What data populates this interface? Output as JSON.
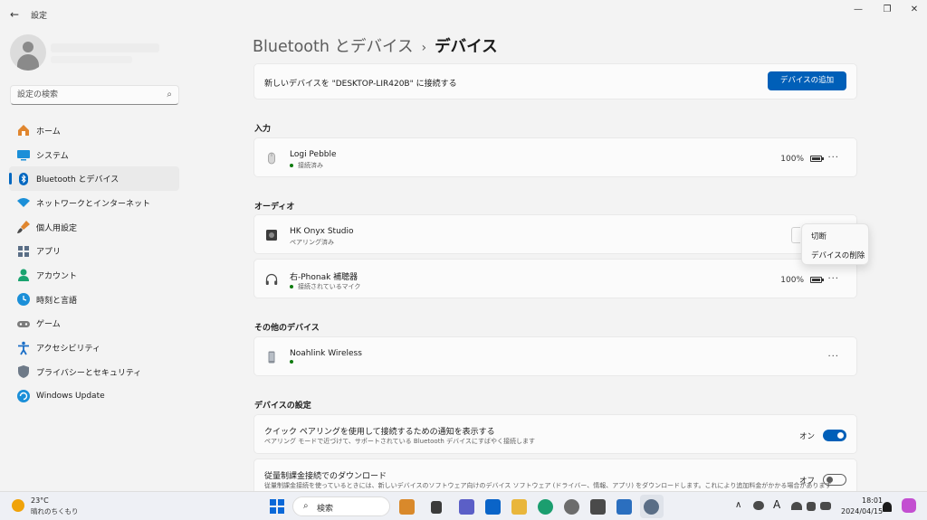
{
  "window": {
    "title": "設定",
    "back_icon": "←",
    "minimize_icon": "—",
    "maximize_icon": "❐",
    "close_icon": "✕"
  },
  "sidebar": {
    "search_placeholder": "設定の検索",
    "search_icon": "⌕",
    "items": [
      {
        "label": "ホーム",
        "icon": "home-icon"
      },
      {
        "label": "システム",
        "icon": "system-icon"
      },
      {
        "label": "Bluetooth とデバイス",
        "icon": "bluetooth-icon",
        "active": true
      },
      {
        "label": "ネットワークとインターネット",
        "icon": "network-icon"
      },
      {
        "label": "個人用設定",
        "icon": "brush-icon"
      },
      {
        "label": "アプリ",
        "icon": "apps-icon"
      },
      {
        "label": "アカウント",
        "icon": "account-icon"
      },
      {
        "label": "時刻と言語",
        "icon": "time-language-icon"
      },
      {
        "label": "ゲーム",
        "icon": "gaming-icon"
      },
      {
        "label": "アクセシビリティ",
        "icon": "accessibility-icon"
      },
      {
        "label": "プライバシーとセキュリティ",
        "icon": "shield-icon"
      },
      {
        "label": "Windows Update",
        "icon": "update-icon"
      }
    ]
  },
  "breadcrumb": {
    "parent": "Bluetooth とデバイス",
    "separator": "›",
    "current": "デバイス"
  },
  "add_device": {
    "text": "新しいデバイスを \"DESKTOP-LIR420B\" に接続する",
    "button": "デバイスの追加"
  },
  "sections": {
    "input": "入力",
    "audio": "オーディオ",
    "other": "その他のデバイス",
    "settings": "デバイスの設定"
  },
  "devices": {
    "mouse": {
      "name": "Logi Pebble",
      "status": "接続済み",
      "battery": "100%",
      "icon": "mouse-icon"
    },
    "speaker": {
      "name": "HK Onyx Studio",
      "status": "ペアリング済み",
      "icon": "speaker-icon"
    },
    "hearing_aid": {
      "name": "右-Phonak 補聴器",
      "status": "接続されているマイク",
      "battery": "100%",
      "icon": "headphones-icon"
    },
    "noahlink": {
      "name": "Noahlink Wireless",
      "status": "",
      "icon": "device-icon"
    }
  },
  "more_label": "···",
  "context_menu": {
    "disconnect": "切断",
    "remove": "デバイスの削除"
  },
  "settings": {
    "swift_pair": {
      "title": "クイック ペアリングを使用して接続するための通知を表示する",
      "desc": "ペアリング モードで近づけて、サポートされている Bluetooth デバイスにすばやく接続します",
      "state": "オン"
    },
    "metered": {
      "title": "従量制課金接続でのダウンロード",
      "desc": "従量制課金接続を使っているときには、新しいデバイスのソフトウェア向けのデバイス ソフトウェア (ドライバー、情報、アプリ) をダウンロードします。これにより追加料金がかかる場合があります",
      "state": "オフ"
    }
  },
  "taskbar": {
    "weather_temp": "23°C",
    "weather_desc": "晴れのちくもり",
    "search_label": "検索",
    "search_icon": "⌕",
    "tray_chevron": "∧",
    "ime_label": "A",
    "time": "18:01",
    "date": "2024/04/15"
  },
  "colors": {
    "accent": "#005fb8",
    "connected_dot": "#0f7b0f"
  }
}
